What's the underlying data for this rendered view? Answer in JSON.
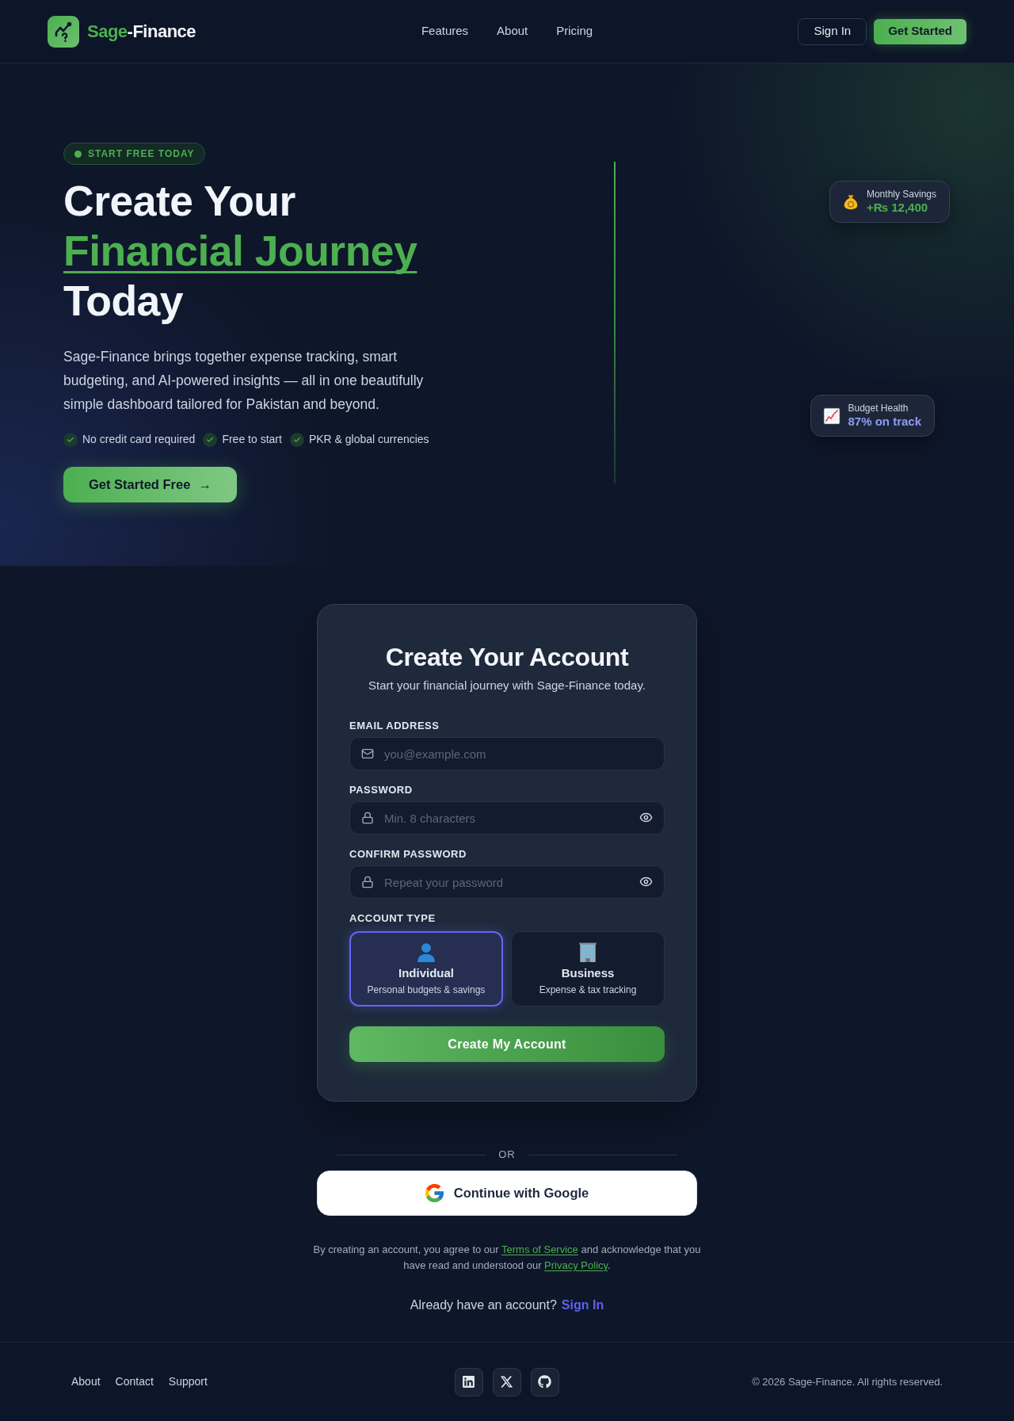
{
  "header": {
    "brand": {
      "accent": "Sage",
      "rest": "-Finance"
    },
    "nav": [
      "Features",
      "About",
      "Pricing"
    ],
    "sign_in": "Sign In",
    "get_started": "Get Started"
  },
  "hero": {
    "badge": "START FREE TODAY",
    "heading": {
      "line_1": "Create Your",
      "highlight": "Financial Journey",
      "line_3": "Today"
    },
    "description": "Sage-Finance brings together expense tracking, smart budgeting, and AI-powered insights — all in one beautifully simple dashboard tailored for Pakistan and beyond.",
    "perks": [
      "No credit card required",
      "Free to start",
      "PKR & global currencies"
    ],
    "cta": {
      "label": "Get Started Free",
      "arrow": "→"
    },
    "stats": [
      {
        "kind": "savings",
        "label": "Monthly Savings",
        "value": "+₨ 12,400",
        "color": "#4caf50"
      },
      {
        "kind": "health",
        "label": "Budget Health",
        "value": "87% on track",
        "color": "#8e9cf4"
      }
    ]
  },
  "signup": {
    "title": "Create Your Account",
    "subtitle": "Start your financial journey with Sage-Finance today.",
    "fields": [
      {
        "kind": "email",
        "label": "EMAIL ADDRESS",
        "placeholder": "you@example.com"
      },
      {
        "kind": "password",
        "label": "PASSWORD",
        "placeholder": "Min. 8 characters"
      },
      {
        "kind": "password",
        "label": "CONFIRM PASSWORD",
        "placeholder": "Repeat your password"
      }
    ],
    "account_type": {
      "label": "ACCOUNT TYPE",
      "options": [
        {
          "kind": "individual",
          "title": "Individual",
          "description": "Personal budgets & savings",
          "selected": true
        },
        {
          "kind": "business",
          "title": "Business",
          "description": "Expense & tax tracking",
          "selected": false
        }
      ]
    },
    "submit": "Create My Account"
  },
  "divider": "OR",
  "google_button": "Continue with Google",
  "terms": {
    "before": "By creating an account, you agree to our ",
    "terms_link": "Terms of Service",
    "middle": " and acknowledge that you have read and understood our ",
    "privacy_link": "Privacy Policy",
    "after": "."
  },
  "sign_in_prompt": {
    "text": "Already have an account?",
    "link": "Sign In"
  },
  "footer": {
    "links": [
      "About",
      "Contact",
      "Support"
    ],
    "social": [
      {
        "kind": "linkedin"
      },
      {
        "kind": "x"
      },
      {
        "kind": "github"
      }
    ],
    "copyright": "© 2026 Sage-Finance. All rights reserved."
  }
}
